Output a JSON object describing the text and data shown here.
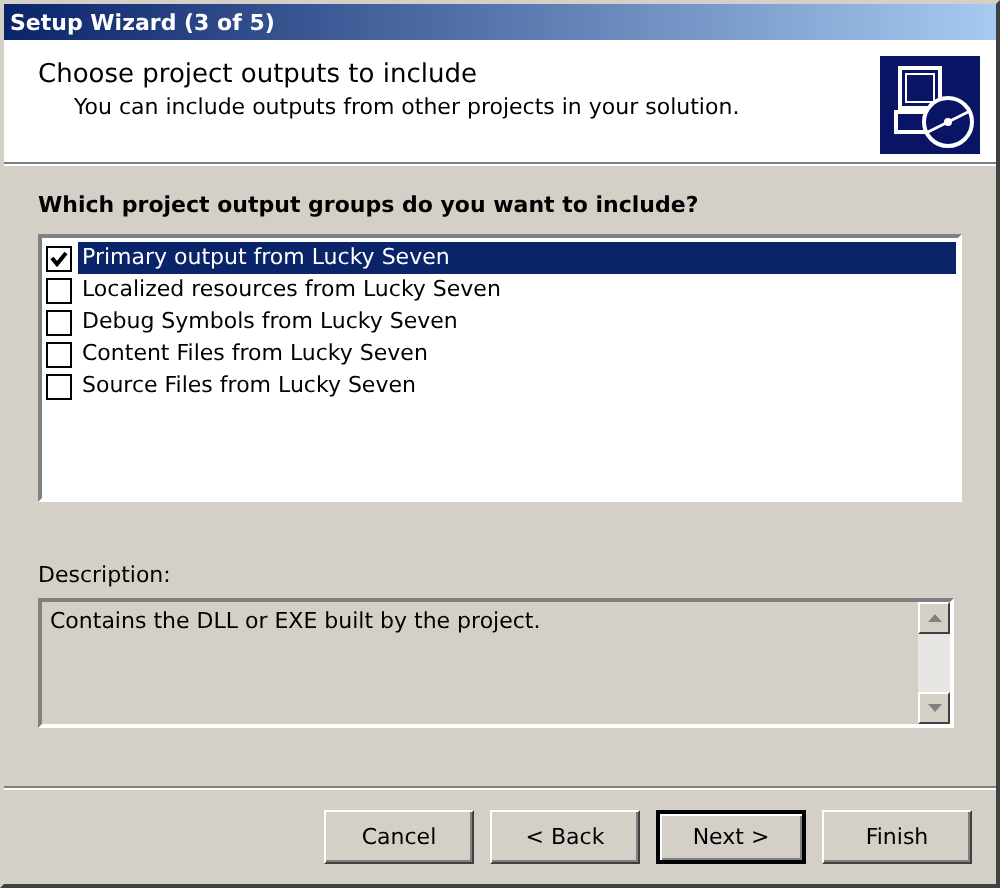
{
  "window": {
    "title": "Setup Wizard (3 of 5)"
  },
  "header": {
    "title": "Choose project outputs to include",
    "subtitle": "You can include outputs from other projects in your solution."
  },
  "question": "Which project output groups do you want to include?",
  "items": [
    {
      "label": "Primary output from Lucky Seven",
      "checked": true,
      "selected": true
    },
    {
      "label": "Localized resources from Lucky Seven",
      "checked": false,
      "selected": false
    },
    {
      "label": "Debug Symbols from Lucky Seven",
      "checked": false,
      "selected": false
    },
    {
      "label": "Content Files from Lucky Seven",
      "checked": false,
      "selected": false
    },
    {
      "label": "Source Files from Lucky Seven",
      "checked": false,
      "selected": false
    }
  ],
  "description": {
    "label": "Description:",
    "text": "Contains the DLL or EXE built by the project."
  },
  "buttons": [
    {
      "label": "Cancel",
      "default": false
    },
    {
      "label": "< Back",
      "default": false
    },
    {
      "label": "Next >",
      "default": true
    },
    {
      "label": "Finish",
      "default": false
    }
  ]
}
